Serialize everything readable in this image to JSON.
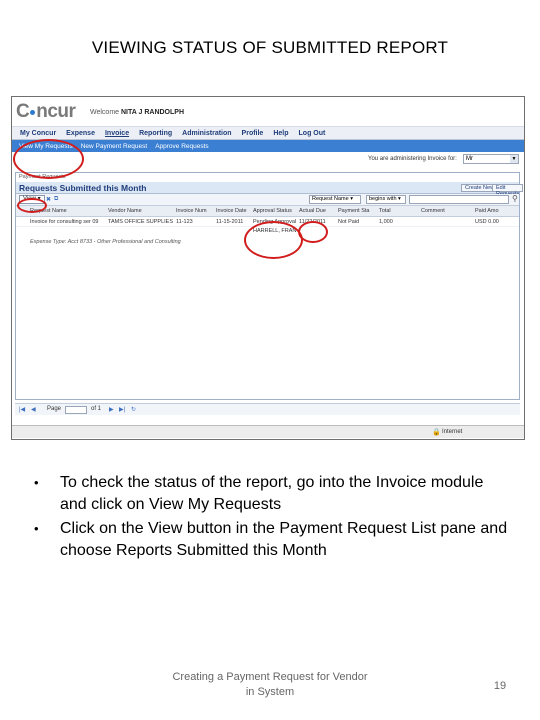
{
  "slide": {
    "title": "VIEWING STATUS OF SUBMITTED REPORT",
    "bullets": [
      "To check the status of the report, go into the Invoice module and click on View My Requests",
      "Click on the View button in the Payment Request List pane and choose Reports Submitted this Month"
    ],
    "footer": "Creating a Payment Request for Vendor in System",
    "page_number": "19"
  },
  "app": {
    "logo": "C",
    "logo_tail": "ncur",
    "welcome": "Welcome",
    "user": "NITA J RANDOLPH",
    "menu": [
      "My Concur",
      "Expense",
      "Invoice",
      "Reporting",
      "Administration",
      "Profile",
      "Help",
      "Log Out"
    ],
    "submenu": [
      "View My Requests",
      "New Payment Request",
      "Approve Requests"
    ],
    "admin_label": "You are administering Invoice for:",
    "admin_value": "Mr",
    "pane_caption": "Payment Requests",
    "pane_title": "Requests Submitted this Month",
    "pane_buttons": [
      "Create New",
      "Edit Requests"
    ],
    "view_button": "View",
    "search_field": "Request Name",
    "search_op": "begins with",
    "columns": [
      "Request Name",
      "Vendor Name",
      "Invoice Num",
      "Invoice Date",
      "Approval Status",
      "Actual Due",
      "Payment Sta",
      "Total",
      "Comment",
      "Paid Amo"
    ],
    "row": {
      "request_name": "Invoice for consulting ser 09",
      "vendor_name": "TAMS OFFICE SUPPLIES",
      "invoice_num": "11-123",
      "invoice_date": "11-15-2011",
      "approval_status": "Pending Approval",
      "approver": "HARRELL, FRAN",
      "actual_due": "11/22/2011",
      "payment_status": "Not Paid",
      "total": "1,000",
      "paid_amount": "USD 0.00"
    },
    "expense_note": "Expense Type: Acct 8733 - Other Professional and Consulting",
    "pager_page_label": "Page",
    "pager_of": "of 1",
    "status_internet": "Internet"
  },
  "colors": {
    "accent_blue": "#3b7fd3",
    "annotation_red": "#d21d1d"
  }
}
